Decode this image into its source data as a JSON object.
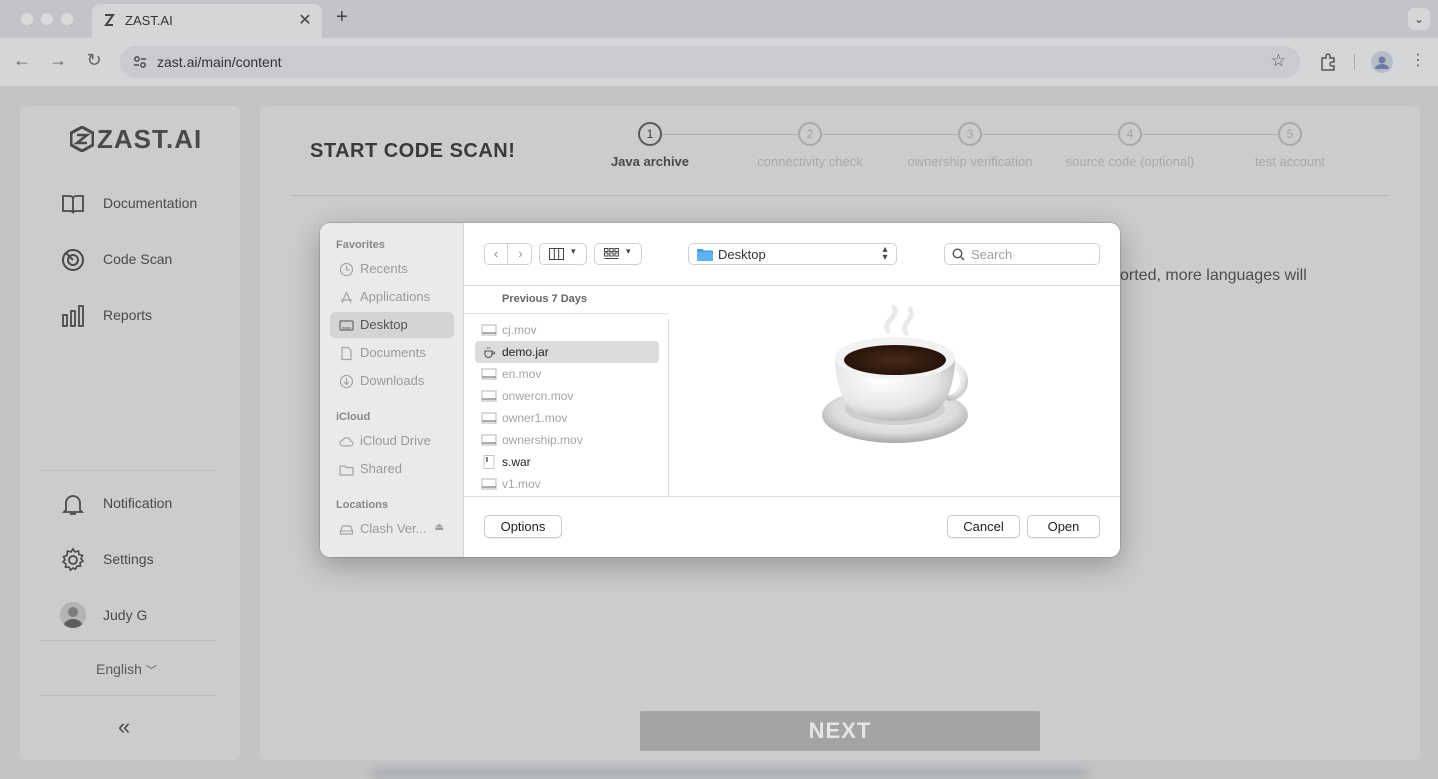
{
  "browser": {
    "tab_title": "ZAST.AI",
    "tab_close": "✕",
    "new_tab": "+",
    "url": "zast.ai/main/content",
    "icons": [
      "back-icon",
      "forward-icon",
      "reload-icon",
      "site-settings-icon",
      "bookmark-star-icon",
      "extensions-icon",
      "profile-icon",
      "more-menu-icon"
    ]
  },
  "sidebar": {
    "logo_text": "ZAST.AI",
    "items": [
      {
        "label": "Documentation",
        "icon": "book-icon"
      },
      {
        "label": "Code Scan",
        "icon": "scan-icon"
      },
      {
        "label": "Reports",
        "icon": "bar-chart-icon"
      }
    ],
    "bottom_items": [
      {
        "label": "Notification",
        "icon": "bell-icon"
      },
      {
        "label": "Settings",
        "icon": "gear-icon"
      },
      {
        "label": "Judy G",
        "icon": "avatar"
      }
    ],
    "language": "English",
    "collapse_glyph": "«"
  },
  "main": {
    "title": "START CODE SCAN!",
    "steps": [
      {
        "number": "1",
        "label": "Java archive",
        "active": true
      },
      {
        "number": "2",
        "label": "connectivity check",
        "active": false
      },
      {
        "number": "3",
        "label": "ownership verification",
        "active": false
      },
      {
        "number": "4",
        "label": "source code (optional)",
        "active": false
      },
      {
        "number": "5",
        "label": "test account",
        "active": false
      }
    ],
    "partial_text": "orted, more languages will",
    "next_label": "NEXT"
  },
  "dialog": {
    "sidebar": {
      "favorites_heading": "Favorites",
      "favorites": [
        {
          "label": "Recents",
          "icon": "clock-icon",
          "selected": false
        },
        {
          "label": "Applications",
          "icon": "applications-icon",
          "selected": false
        },
        {
          "label": "Desktop",
          "icon": "desktop-icon",
          "selected": true
        },
        {
          "label": "Documents",
          "icon": "document-icon",
          "selected": false
        },
        {
          "label": "Downloads",
          "icon": "download-icon",
          "selected": false
        }
      ],
      "icloud_heading": "iCloud",
      "icloud": [
        {
          "label": "iCloud Drive",
          "icon": "cloud-icon"
        },
        {
          "label": "Shared",
          "icon": "shared-folder-icon"
        }
      ],
      "locations_heading": "Locations",
      "locations": [
        {
          "label": "Clash Ver...",
          "icon": "drive-icon",
          "eject": "⏏"
        }
      ]
    },
    "toolbar": {
      "back": "‹",
      "forward": "›",
      "location": "Desktop",
      "search_placeholder": "Search"
    },
    "list_header": "Previous 7 Days",
    "files": [
      {
        "name": "cj.mov",
        "enabled": false,
        "selected": false
      },
      {
        "name": "demo.jar",
        "enabled": true,
        "selected": true
      },
      {
        "name": "en.mov",
        "enabled": false,
        "selected": false
      },
      {
        "name": "onwercn.mov",
        "enabled": false,
        "selected": false
      },
      {
        "name": "owner1.mov",
        "enabled": false,
        "selected": false
      },
      {
        "name": "ownership.mov",
        "enabled": false,
        "selected": false
      },
      {
        "name": "s.war",
        "enabled": true,
        "selected": false
      },
      {
        "name": "v1.mov",
        "enabled": false,
        "selected": false
      }
    ],
    "options_label": "Options",
    "cancel_label": "Cancel",
    "open_label": "Open"
  }
}
